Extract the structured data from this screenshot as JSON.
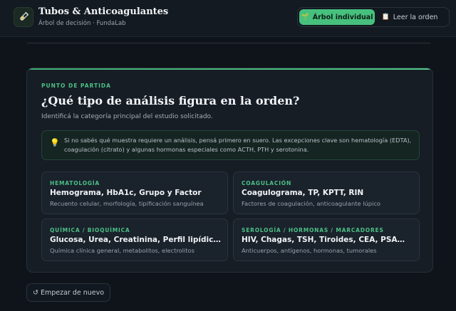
{
  "header": {
    "title": "Tubos & Anticoagulantes",
    "subtitle": "Árbol de decisión · FundaLab",
    "logo_icon": "test-tube-icon"
  },
  "tabs": [
    {
      "label": "Árbol individual",
      "icon": "🌱",
      "active": true
    },
    {
      "label": "Leer la orden",
      "icon": "📋",
      "active": false
    }
  ],
  "card": {
    "eyebrow": "PUNTO DE PARTIDA",
    "question": "¿Qué tipo de análisis figura en la orden?",
    "hint": "Identificá la categoría principal del estudio solicitado.",
    "tip": "Si no sabés qué muestra requiere un análisis, pensá primero en suero. Las excepciones clave son hematología (EDTA), coagulación (citrato) y algunas hormonas especiales como ACTH, PTH y serotonina.",
    "tip_icon": "💡"
  },
  "options": [
    {
      "category": "HEMATOLOGÍA",
      "title": "Hemograma, HbA1c, Grupo y Factor",
      "desc": "Recuento celular, morfología, tipificación sanguínea"
    },
    {
      "category": "COAGULACIÓN",
      "title": "Coagulograma, TP, KPTT, RIN",
      "desc": "Factores de coagulación, anticoagulante lúpico"
    },
    {
      "category": "QUÍMICA / BIOQUÍMICA",
      "title": "Glucosa, Urea, Creatinina, Perfil lipídico…",
      "desc": "Química clínica general, metabolitos, electrolitos"
    },
    {
      "category": "SEROLOGÍA / HORMONAS / MARCADORES",
      "title": "HIV, Chagas, TSH, Tiroides, CEA, PSA…",
      "desc": "Anticuerpos, antígenos, hormonas, tumorales"
    }
  ],
  "restart_label": "↺ Empezar de nuevo",
  "colors": {
    "accent": "#47c07e",
    "background": "#0f141a",
    "card": "#161d25"
  }
}
